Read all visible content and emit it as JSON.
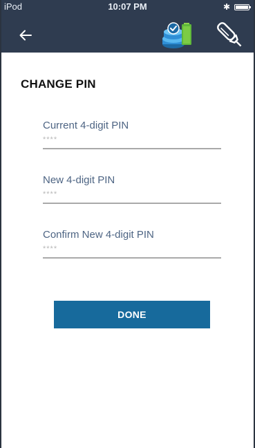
{
  "status_bar": {
    "carrier": "iPod",
    "time": "10:07 PM",
    "bluetooth_icon": "bluetooth-icon",
    "battery_icon": "battery-full-icon"
  },
  "header": {
    "back_icon": "back-arrow-icon",
    "device_status_icon": "device-connected-battery-icon",
    "pen_icon": "insulin-pen-icon",
    "background_color": "#2f3c50"
  },
  "page": {
    "title": "CHANGE PIN"
  },
  "fields": [
    {
      "label": "Current 4-digit PIN",
      "placeholder": "****",
      "value": ""
    },
    {
      "label": "New 4-digit PIN",
      "placeholder": "****",
      "value": ""
    },
    {
      "label": "Confirm New 4-digit PIN",
      "placeholder": "****",
      "value": ""
    }
  ],
  "actions": {
    "done_label": "DONE",
    "done_color": "#176a9c"
  }
}
